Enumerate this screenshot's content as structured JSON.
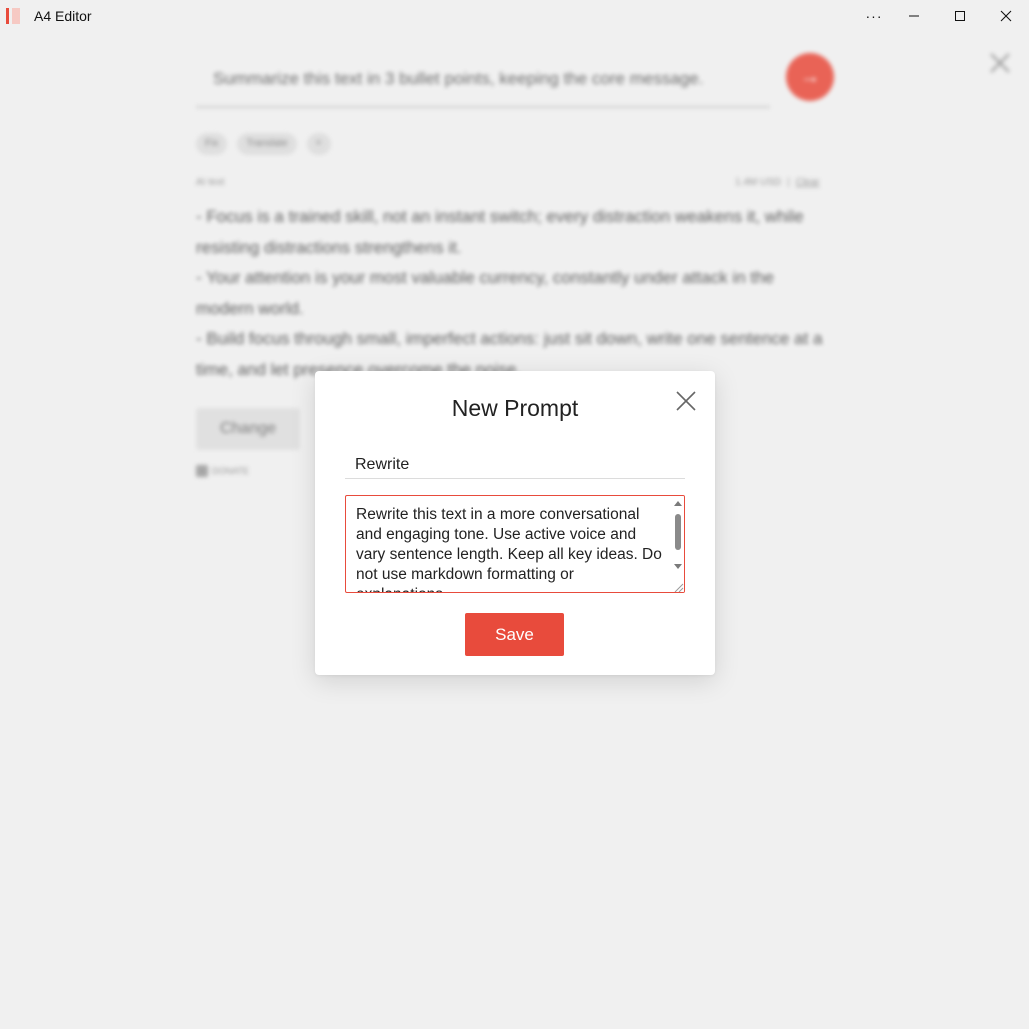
{
  "app": {
    "title": "A4 Editor",
    "accent_color": "#e84b3c"
  },
  "titlebar": {
    "more_icon": "more-icon",
    "minimize_icon": "minimize-icon",
    "maximize_icon": "maximize-icon",
    "close_icon": "close-icon"
  },
  "background": {
    "prompt_text": "Summarize this text in 3 bullet points, keeping the core message.",
    "chips": [
      "Fix",
      "Translate",
      "+"
    ],
    "label_left": "AI text",
    "word_count": "1.4M USD",
    "divider": "|",
    "clear_label": "Clear",
    "result_lines": [
      "- Focus is a trained skill, not an instant switch; every distraction weakens it, while resisting distractions strengthens it.",
      "- Your attention is your most valuable currency, constantly under attack in the modern world.",
      "- Build focus through small, imperfect actions: just sit down, write one sentence at a time, and let presence overcome the noise."
    ],
    "change_label": "Change",
    "donate_label": "DONATE"
  },
  "dialog": {
    "title": "New Prompt",
    "name_value": "Rewrite",
    "prompt_value": "Rewrite this text in a more conversational and engaging tone. Use active voice and vary sentence length. Keep all key ideas. Do not use markdown formatting or explanations.",
    "save_label": "Save"
  }
}
